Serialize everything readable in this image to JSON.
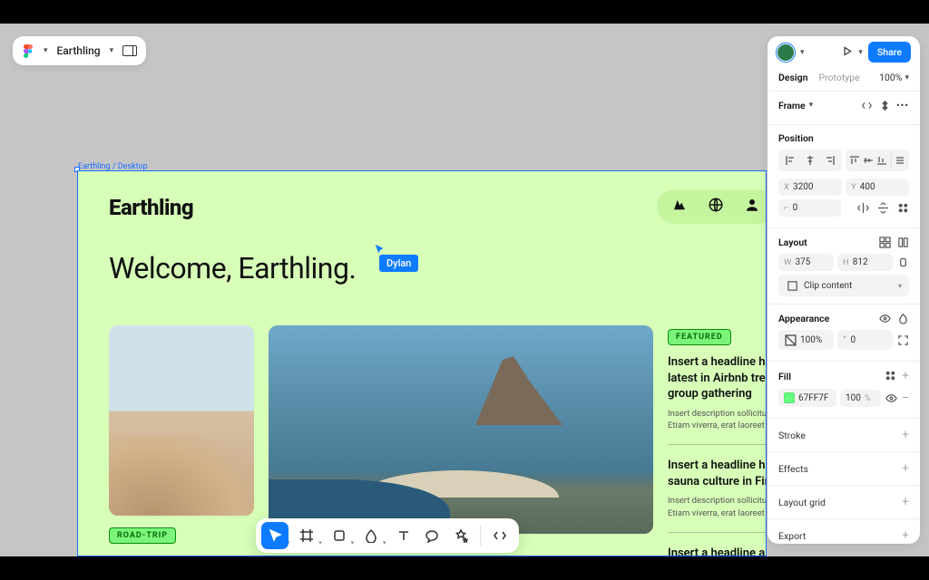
{
  "topbar": {
    "project_name": "Earthling"
  },
  "canvas": {
    "frame_path": "Earthling / Desktop",
    "brand": "Earthling",
    "hero": "Welcome, Earthling.",
    "cursor_user": "Dylan",
    "featured_label": "FEATURED",
    "roadtrip_label": "ROAD-TRIP",
    "articles": [
      {
        "headline": "Insert a headline here about the latest in Airbnb trends for a large group gathering",
        "desc": "Insert description sollicitudin eros tempus. Etiam viverra, erat laoreet"
      },
      {
        "headline": "Insert a headline here about sauna culture in Finland",
        "desc": "Insert description sollicitudin eros tempus. Etiam viverra, erat laoreet"
      },
      {
        "headline": "Insert a headline about",
        "desc": ""
      }
    ]
  },
  "inspector": {
    "share_label": "Share",
    "tabs": {
      "design": "Design",
      "prototype": "Prototype"
    },
    "zoom": "100%",
    "frame_label": "Frame",
    "sections": {
      "position": "Position",
      "layout": "Layout",
      "appearance": "Appearance",
      "fill": "Fill",
      "stroke": "Stroke",
      "effects": "Effects",
      "layout_grid": "Layout grid",
      "export": "Export"
    },
    "position": {
      "x_lbl": "X",
      "x": "3200",
      "y_lbl": "Y",
      "y": "400",
      "r_lbl": "⌐",
      "r": "0"
    },
    "layout": {
      "w_lbl": "W",
      "w": "375",
      "h_lbl": "H",
      "h": "812",
      "clip": "Clip content"
    },
    "appearance": {
      "opacity": "100%",
      "radius": "0"
    },
    "fill": {
      "hex": "67FF7F",
      "pct": "100",
      "unit": "%"
    }
  }
}
